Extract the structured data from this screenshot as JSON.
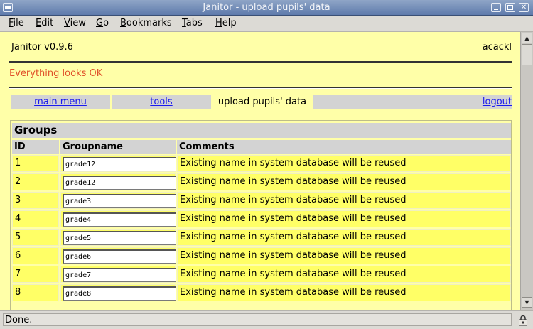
{
  "window": {
    "title": "Janitor - upload pupils' data"
  },
  "menu": [
    {
      "label": "File",
      "ul": "F",
      "rest": "ile"
    },
    {
      "label": "Edit",
      "ul": "E",
      "rest": "dit"
    },
    {
      "label": "View",
      "ul": "V",
      "rest": "iew"
    },
    {
      "label": "Go",
      "ul": "G",
      "rest": "o"
    },
    {
      "label": "Bookmarks",
      "ul": "B",
      "rest": "ookmarks"
    },
    {
      "label": "Tabs",
      "ul": "T",
      "rest": "abs"
    },
    {
      "label": "Help",
      "ul": "H",
      "rest": "elp"
    }
  ],
  "header": {
    "app_version": "Janitor v0.9.6",
    "user": "acackl"
  },
  "status_message": "Everything looks OK",
  "nav": {
    "main_menu": "main menu",
    "tools": "tools",
    "current": "upload pupils' data",
    "logout": "logout"
  },
  "groups": {
    "title": "Groups",
    "columns": [
      "ID",
      "Groupname",
      "Comments"
    ],
    "rows": [
      {
        "id": "1",
        "groupname": "grade12",
        "comment": "Existing name in system database will be reused"
      },
      {
        "id": "2",
        "groupname": "grade12",
        "comment": "Existing name in system database will be reused"
      },
      {
        "id": "3",
        "groupname": "grade3",
        "comment": "Existing name in system database will be reused"
      },
      {
        "id": "4",
        "groupname": "grade4",
        "comment": "Existing name in system database will be reused"
      },
      {
        "id": "5",
        "groupname": "grade5",
        "comment": "Existing name in system database will be reused"
      },
      {
        "id": "6",
        "groupname": "grade6",
        "comment": "Existing name in system database will be reused"
      },
      {
        "id": "7",
        "groupname": "grade7",
        "comment": "Existing name in system database will be reused"
      },
      {
        "id": "8",
        "groupname": "grade8",
        "comment": "Existing name in system database will be reused"
      }
    ]
  },
  "statusbar": {
    "text": "Done."
  },
  "icons": {
    "security": "lock-icon"
  },
  "colors": {
    "page_bg": "#ffffa8",
    "row_bg": "#ffff66",
    "header_bg": "#d3d3d3",
    "status_msg": "#e0512a",
    "link": "#1a1aee"
  }
}
